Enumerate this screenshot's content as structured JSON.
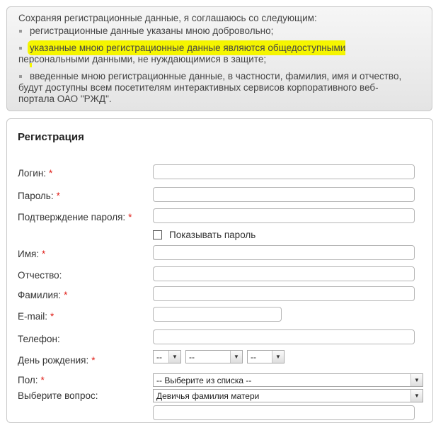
{
  "agreement": {
    "intro": "Сохраняя регистрационные данные, я соглашаюсь со следующим:",
    "items": [
      {
        "text": "регистрационные данные указаны мною добровольно;"
      },
      {
        "line1": "указанные мною регистрационные данные являются общедоступными",
        "line2": "персональными данными, не нуждающимися в защите;"
      },
      {
        "line1": "введенные мною регистрационные данные, в частности, фамилия, имя и отчество,",
        "line2": "будут доступны всем посетителям интерактивных сервисов корпоративного веб-",
        "line3": "портала ОАО \"РЖД\"."
      }
    ]
  },
  "registration": {
    "title": "Регистрация",
    "required_mark": "*",
    "login_label": "Логин:",
    "password_label": "Пароль:",
    "confirm_label": "Подтверждение пароля:",
    "show_password_label": "Показывать пароль",
    "first_name_label": "Имя:",
    "patronymic_label": "Отчество:",
    "last_name_label": "Фамилия:",
    "email_label": "E-mail:",
    "phone_label": "Телефон:",
    "birthday_label": "День рождения:",
    "birthday_day": "--",
    "birthday_month": "--",
    "birthday_year": "--",
    "gender_label": "Пол:",
    "gender_value": "-- Выберите из списка --",
    "question_label": "Выберите вопрос:",
    "question_value": "Девичья фамилия матери"
  },
  "colors": {
    "highlight": "#f5f500",
    "required": "#e0201a",
    "panel_border": "#c8c8c8"
  }
}
